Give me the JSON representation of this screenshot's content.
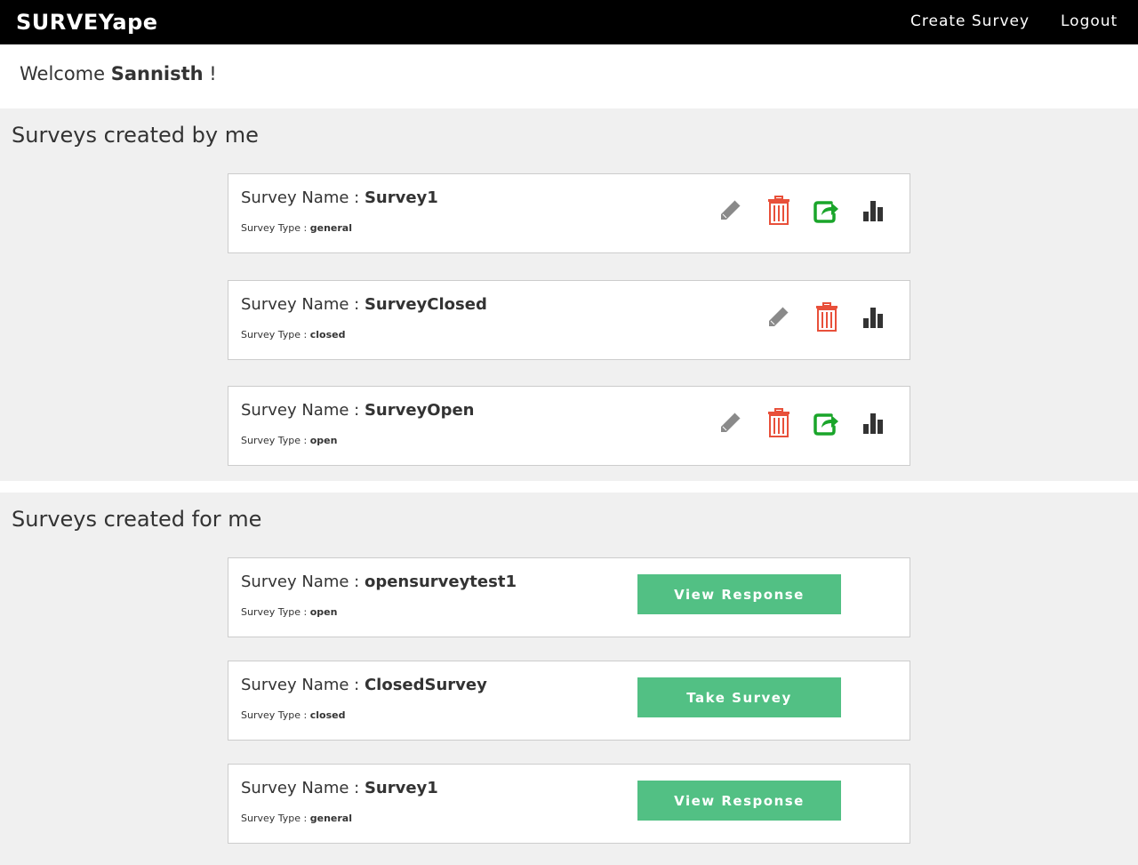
{
  "navbar": {
    "brand": "SURVEYape",
    "create_survey": "Create Survey",
    "logout": "Logout"
  },
  "welcome": {
    "prefix": "Welcome ",
    "user": "Sannisth",
    "suffix": " !"
  },
  "created_by_me": {
    "title": "Surveys created by me",
    "name_label": "Survey Name : ",
    "type_label": "Survey Type : ",
    "items": [
      {
        "name": "Survey1",
        "type": "general",
        "icons": [
          "pencil-icon",
          "trash-icon",
          "share-icon",
          "bar-chart-icon"
        ]
      },
      {
        "name": "SurveyClosed",
        "type": "closed",
        "icons": [
          "pencil-icon",
          "trash-icon",
          "bar-chart-icon"
        ]
      },
      {
        "name": "SurveyOpen",
        "type": "open",
        "icons": [
          "pencil-icon",
          "trash-icon",
          "share-icon",
          "bar-chart-icon"
        ]
      }
    ]
  },
  "created_for_me": {
    "title": "Surveys created for me",
    "name_label": "Survey Name : ",
    "type_label": "Survey Type : ",
    "items": [
      {
        "name": "opensurveytest1",
        "type": "open",
        "action": "View Response"
      },
      {
        "name": "ClosedSurvey",
        "type": "closed",
        "action": "Take Survey"
      },
      {
        "name": "Survey1",
        "type": "general",
        "action": "View Response"
      }
    ]
  },
  "colors": {
    "navbar": "#000000",
    "pencil": "#8a8a8a",
    "trash": "#e8503a",
    "share": "#1aa52a",
    "chart": "#333333",
    "button": "#52c084"
  }
}
